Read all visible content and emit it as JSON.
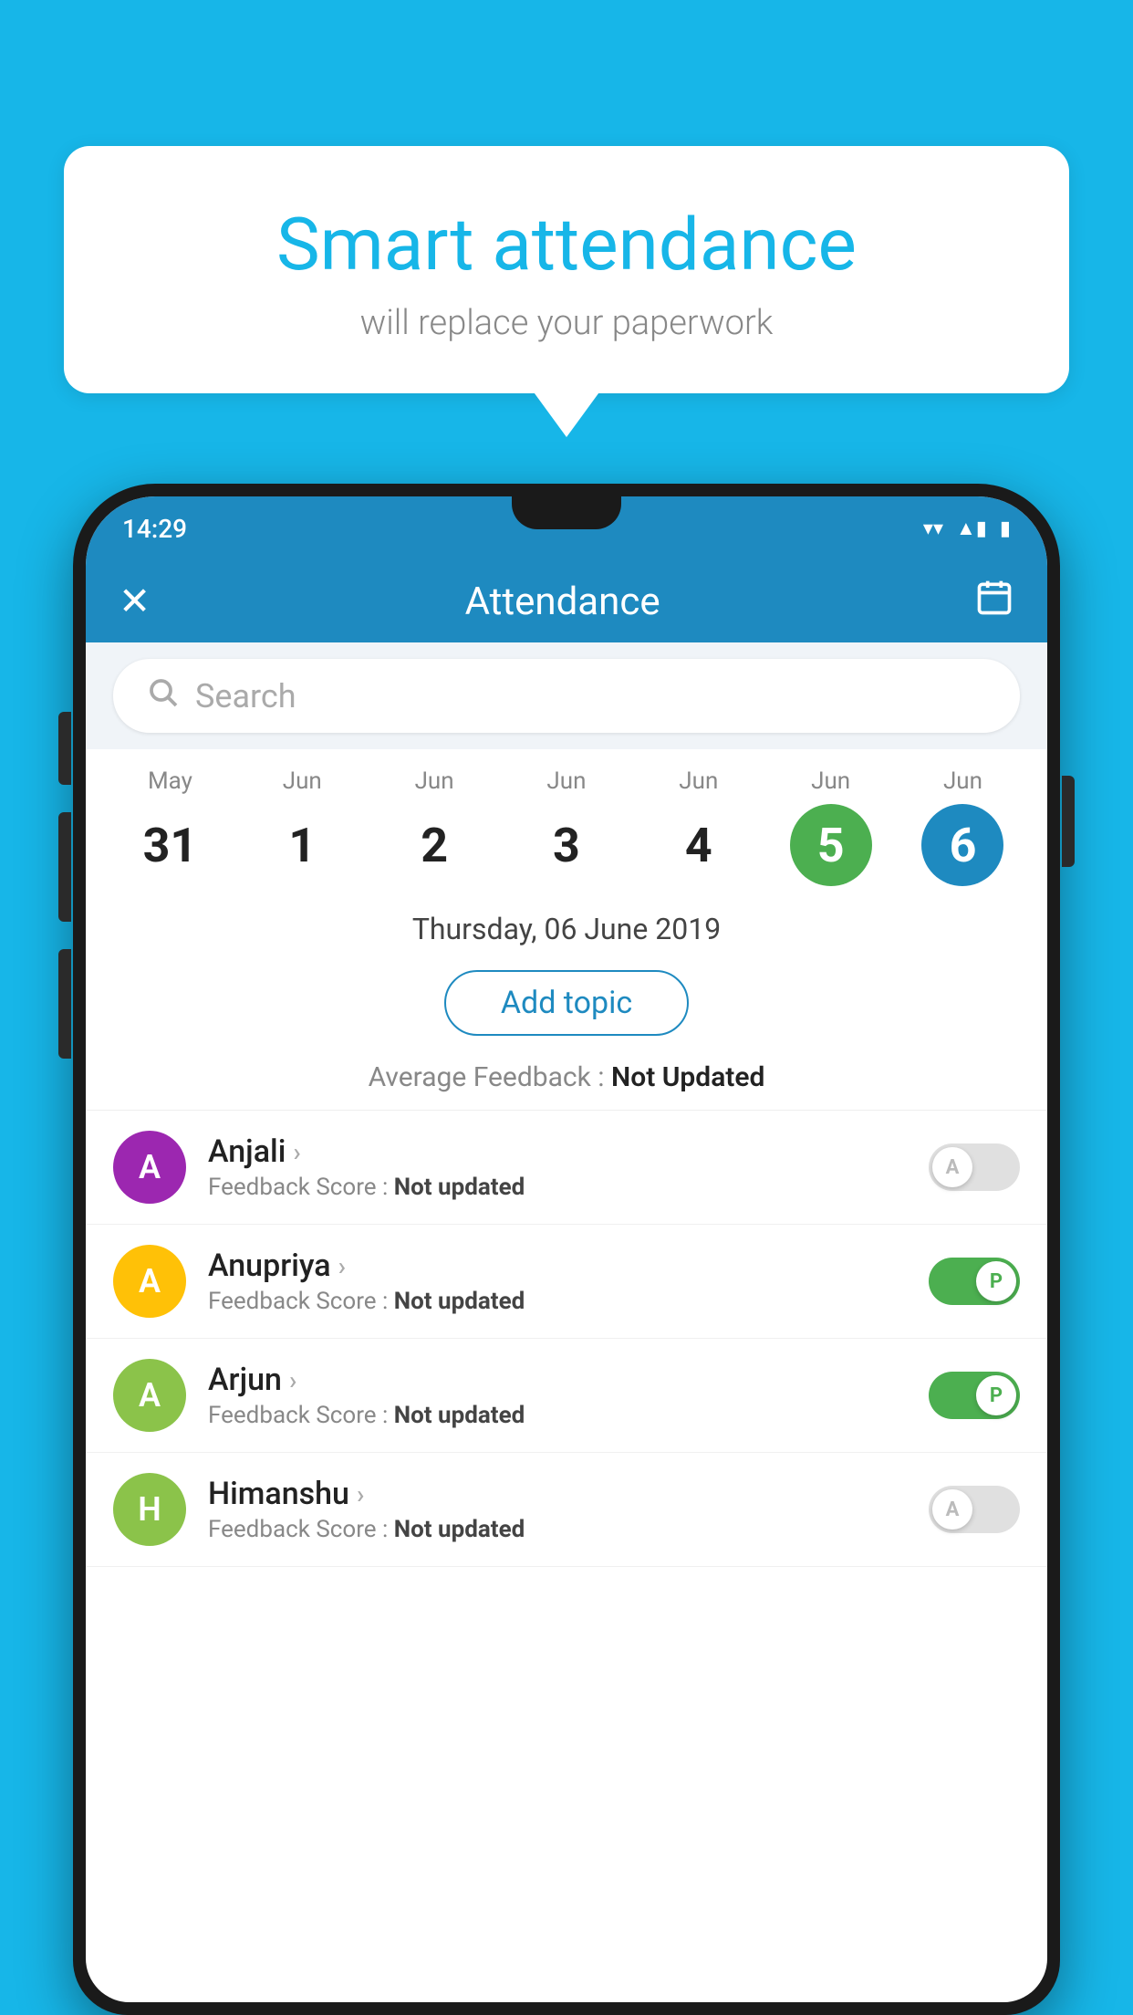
{
  "background_color": "#17b6e8",
  "bubble": {
    "title": "Smart attendance",
    "subtitle": "will replace your paperwork"
  },
  "status_bar": {
    "time": "14:29",
    "wifi_icon": "▼",
    "signal_icon": "▲",
    "battery_icon": "▮"
  },
  "header": {
    "close_icon": "✕",
    "title": "Attendance",
    "calendar_icon": "📅"
  },
  "search": {
    "placeholder": "Search"
  },
  "calendar": {
    "days": [
      {
        "month": "May",
        "date": "31",
        "style": "normal"
      },
      {
        "month": "Jun",
        "date": "1",
        "style": "normal"
      },
      {
        "month": "Jun",
        "date": "2",
        "style": "normal"
      },
      {
        "month": "Jun",
        "date": "3",
        "style": "normal"
      },
      {
        "month": "Jun",
        "date": "4",
        "style": "normal"
      },
      {
        "month": "Jun",
        "date": "5",
        "style": "green"
      },
      {
        "month": "Jun",
        "date": "6",
        "style": "blue"
      }
    ]
  },
  "selected_date": "Thursday, 06 June 2019",
  "add_topic_label": "Add topic",
  "avg_feedback": {
    "label": "Average Feedback : ",
    "value": "Not Updated"
  },
  "students": [
    {
      "name": "Anjali",
      "avatar_letter": "A",
      "avatar_color": "#9c27b0",
      "feedback_label": "Feedback Score : ",
      "feedback_value": "Not updated",
      "toggle_state": "off",
      "toggle_label": "A"
    },
    {
      "name": "Anupriya",
      "avatar_letter": "A",
      "avatar_color": "#ffc107",
      "feedback_label": "Feedback Score : ",
      "feedback_value": "Not updated",
      "toggle_state": "on",
      "toggle_label": "P"
    },
    {
      "name": "Arjun",
      "avatar_letter": "A",
      "avatar_color": "#8bc34a",
      "feedback_label": "Feedback Score : ",
      "feedback_value": "Not updated",
      "toggle_state": "on",
      "toggle_label": "P"
    },
    {
      "name": "Himanshu",
      "avatar_letter": "H",
      "avatar_color": "#8bc34a",
      "feedback_label": "Feedback Score : ",
      "feedback_value": "Not updated",
      "toggle_state": "off",
      "toggle_label": "A"
    }
  ]
}
